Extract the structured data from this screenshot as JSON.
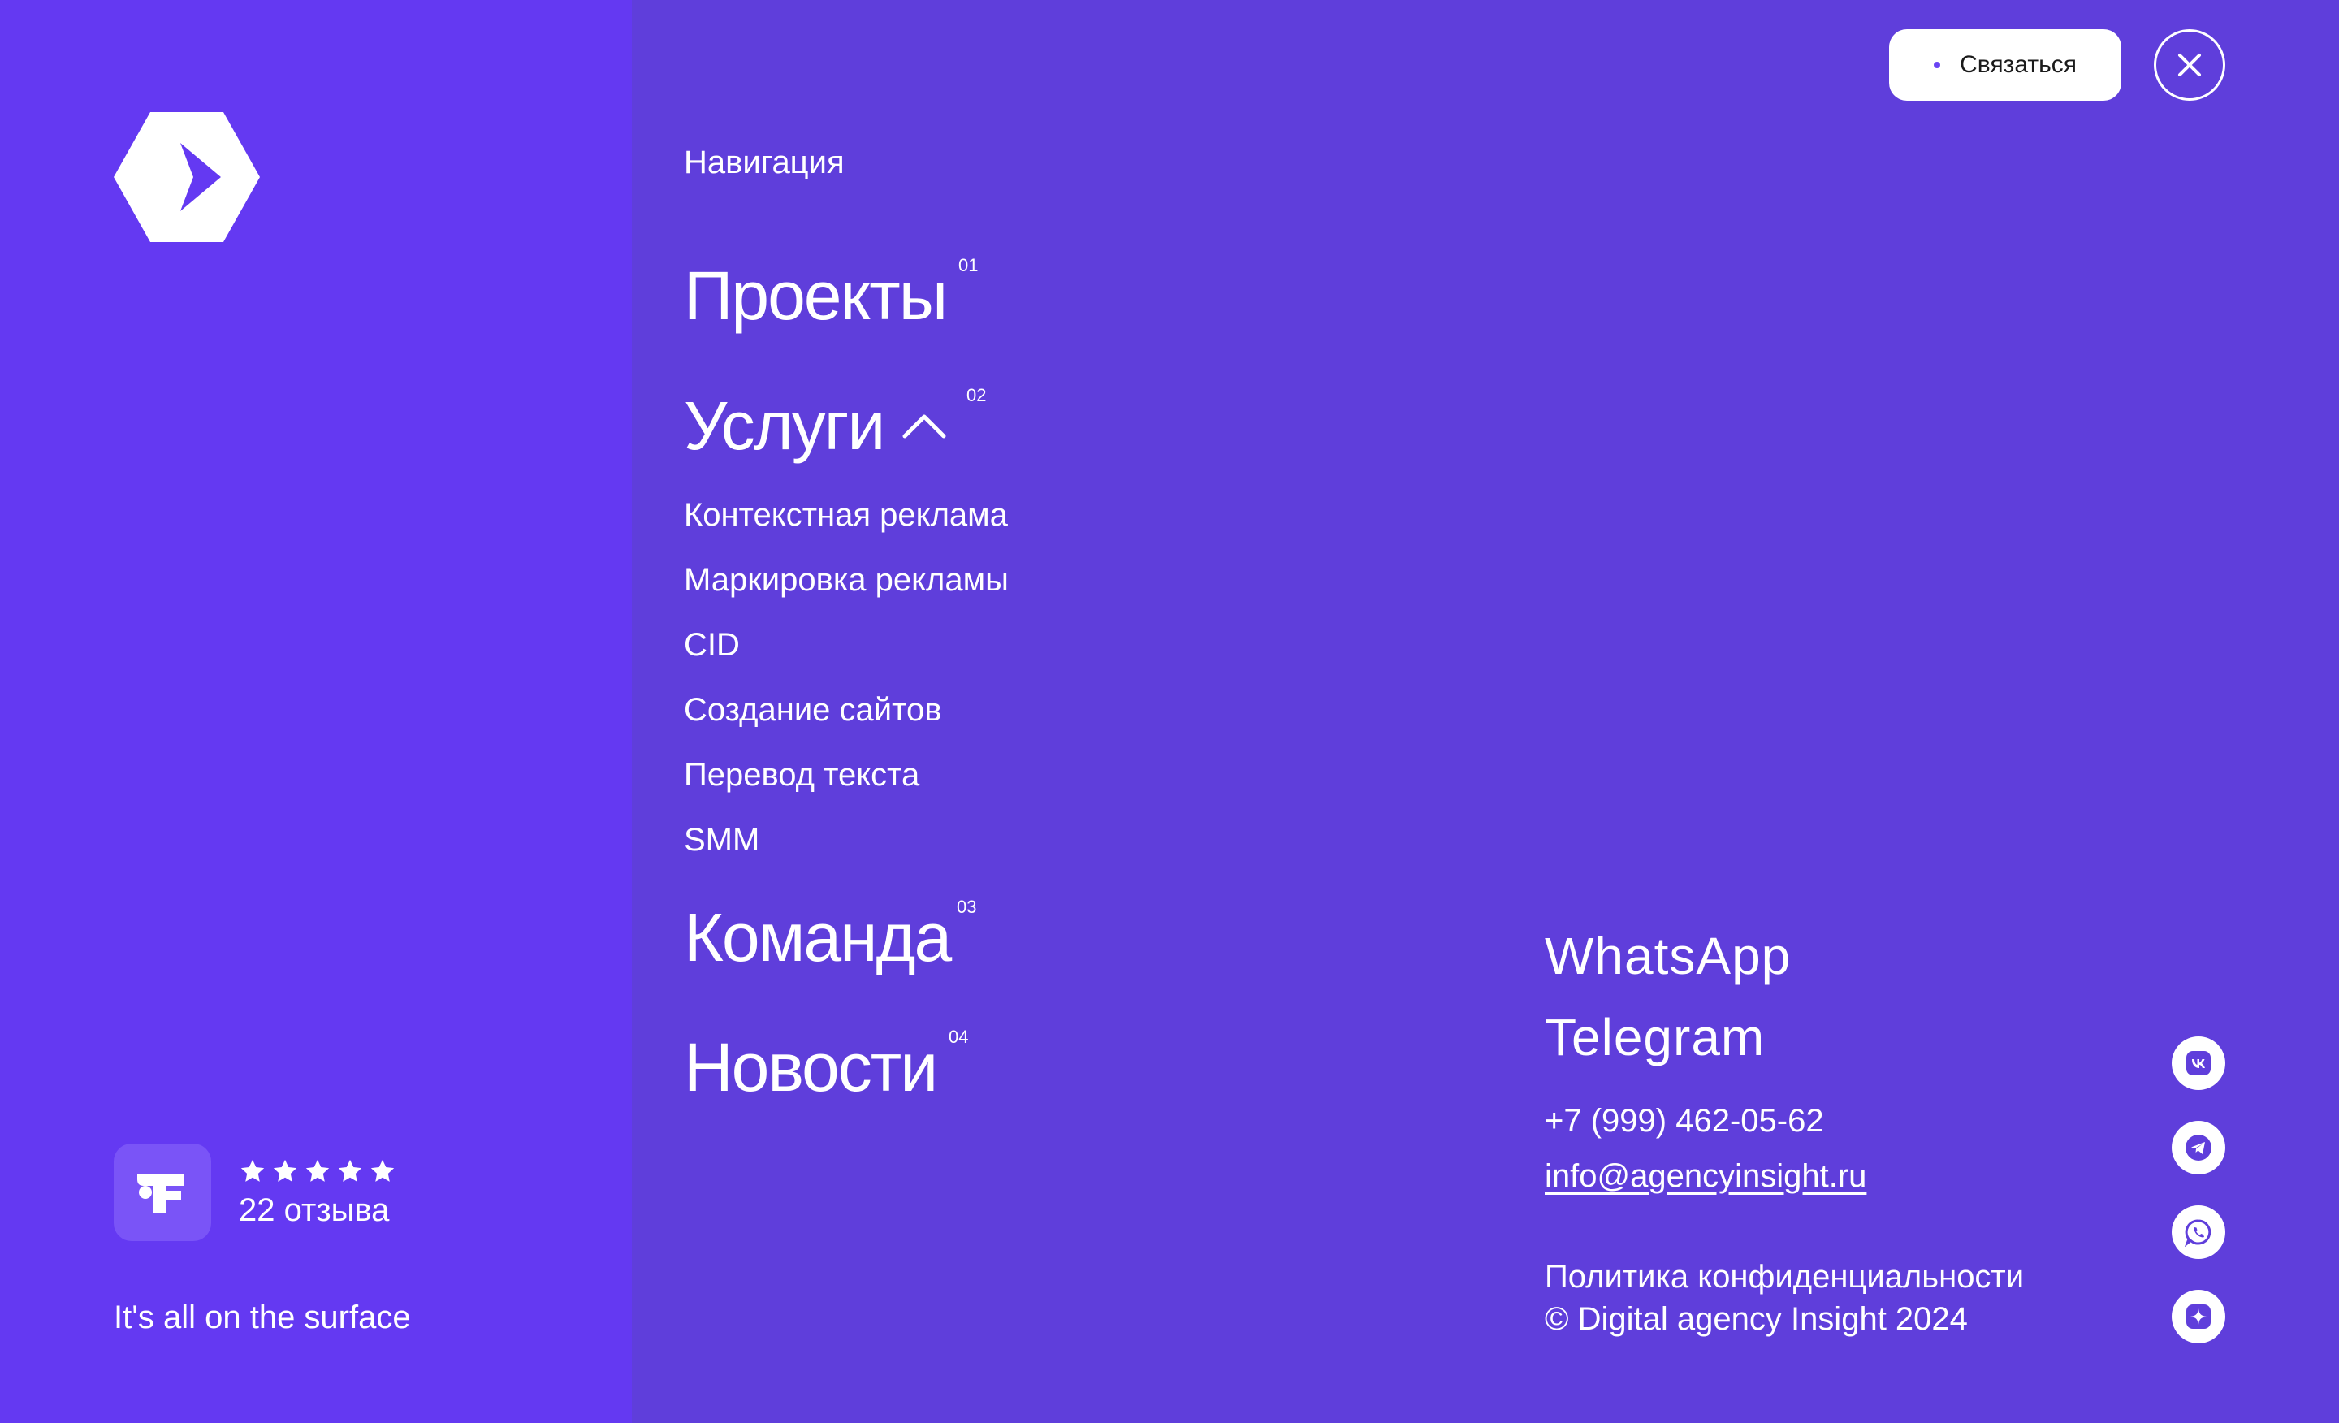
{
  "brand": {
    "logo_icon": "hexagon-arrow-logo-icon",
    "tagline": "It's all on the surface"
  },
  "rating": {
    "badge_icon": "review-platform-icon",
    "stars": 5,
    "reviews_label": "22 отзыва"
  },
  "nav": {
    "heading": "Навигация",
    "items": [
      {
        "label": "Проекты",
        "number": "01"
      },
      {
        "label": "Услуги",
        "number": "02",
        "expanded": true,
        "icon": "chevron-up-icon"
      },
      {
        "label": "Команда",
        "number": "03"
      },
      {
        "label": "Новости",
        "number": "04"
      }
    ],
    "services": [
      "Контекстная реклама",
      "Маркировка рекламы",
      "CID",
      "Создание сайтов",
      "Перевод текста",
      "SMM"
    ]
  },
  "header": {
    "contact_button": "Связаться",
    "close_icon": "close-icon"
  },
  "contacts": {
    "whatsapp": "WhatsApp",
    "telegram": "Telegram",
    "phone": "+7 (999) 462-05-62",
    "email": "info@agencyinsight.ru",
    "privacy": "Политика конфиденциальности",
    "copyright": "© Digital agency Insight 2024"
  },
  "social": [
    "vk-icon",
    "telegram-icon",
    "whatsapp-icon",
    "sparkle-icon"
  ],
  "colors": {
    "left_panel": "#6439f2",
    "right_panel": "#5f3edb",
    "text": "#ffffff"
  }
}
